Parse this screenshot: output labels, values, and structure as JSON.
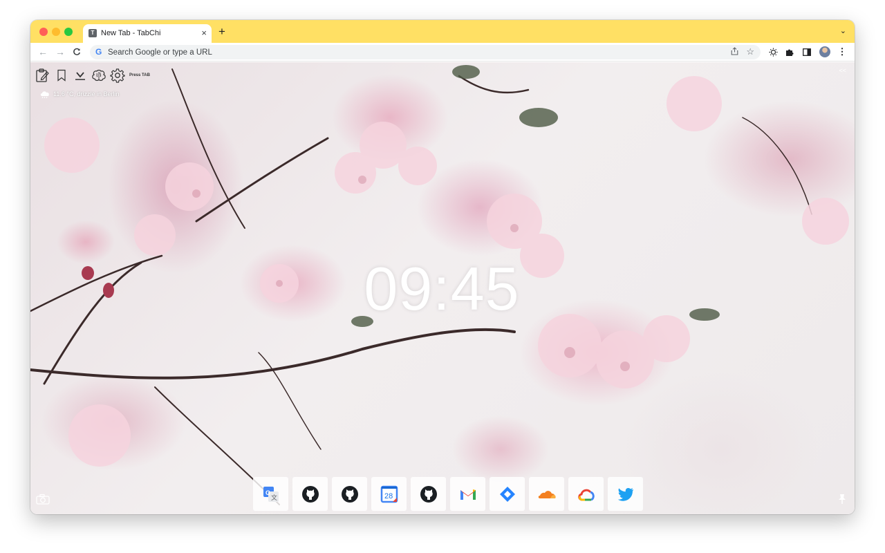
{
  "browser": {
    "tab_title": "New Tab - TabChi",
    "tab_favicon_letter": "T",
    "tab_close": "×",
    "new_tab": "+",
    "tab_menu": "⌄",
    "omnibox_text": "Search Google or type a URL",
    "omnibox_icon": "G",
    "nav": {
      "back": "←",
      "forward": "→",
      "reload": "C"
    },
    "menu": "⋮"
  },
  "tabchi": {
    "press_tab": "Press TAB",
    "weather": "11.6 °C, drizzle in Berlin",
    "collapse": "<<",
    "clock": "09:45",
    "tools": [
      "notes-icon",
      "bookmark-icon",
      "download-icon",
      "brain-icon",
      "settings-icon"
    ],
    "shortcuts": [
      {
        "name": "google-translate-icon"
      },
      {
        "name": "github-icon"
      },
      {
        "name": "github-icon"
      },
      {
        "name": "google-calendar-icon",
        "text": "28"
      },
      {
        "name": "github-icon"
      },
      {
        "name": "gmail-icon"
      },
      {
        "name": "jira-icon"
      },
      {
        "name": "cloudflare-icon"
      },
      {
        "name": "google-cloud-icon"
      },
      {
        "name": "twitter-icon"
      }
    ]
  },
  "colors": {
    "tab_strip": "#FFE064",
    "close": "#FF5F57",
    "minimize": "#FEBC2E",
    "maximize": "#28C840"
  }
}
